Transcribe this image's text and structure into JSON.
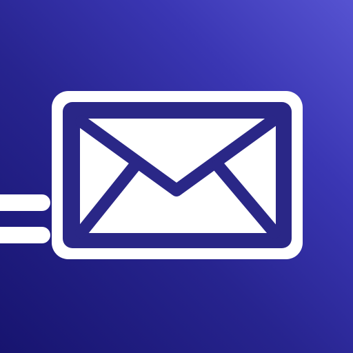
{
  "app_icon": {
    "icon": "envelope-fast-send-icon",
    "motion_lines_icon": "speed-lines-icon",
    "colors": {
      "background_gradient_start": "#5653d1",
      "background_gradient_mid": "#2b2796",
      "background_gradient_end": "#17146f",
      "envelope_body": "#ffffff",
      "envelope_border": "#2a2787",
      "motion_lines": "#ffffff"
    }
  }
}
